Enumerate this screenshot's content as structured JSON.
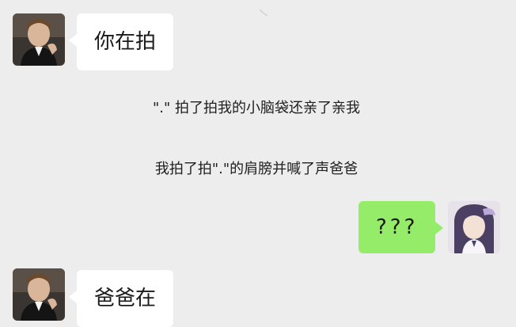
{
  "messages": [
    {
      "text": "你在拍"
    },
    {
      "text": "爸爸在"
    }
  ],
  "system_notices": [
    {
      "text": "\".\" 拍了拍我的小脑袋还亲了亲我"
    },
    {
      "text": "我拍了拍\".\"的肩膀并喊了声爸爸"
    }
  ],
  "reply": {
    "text": "???"
  },
  "colors": {
    "background": "#ededed",
    "incoming_bubble": "#ffffff",
    "outgoing_bubble": "#95ec69"
  }
}
